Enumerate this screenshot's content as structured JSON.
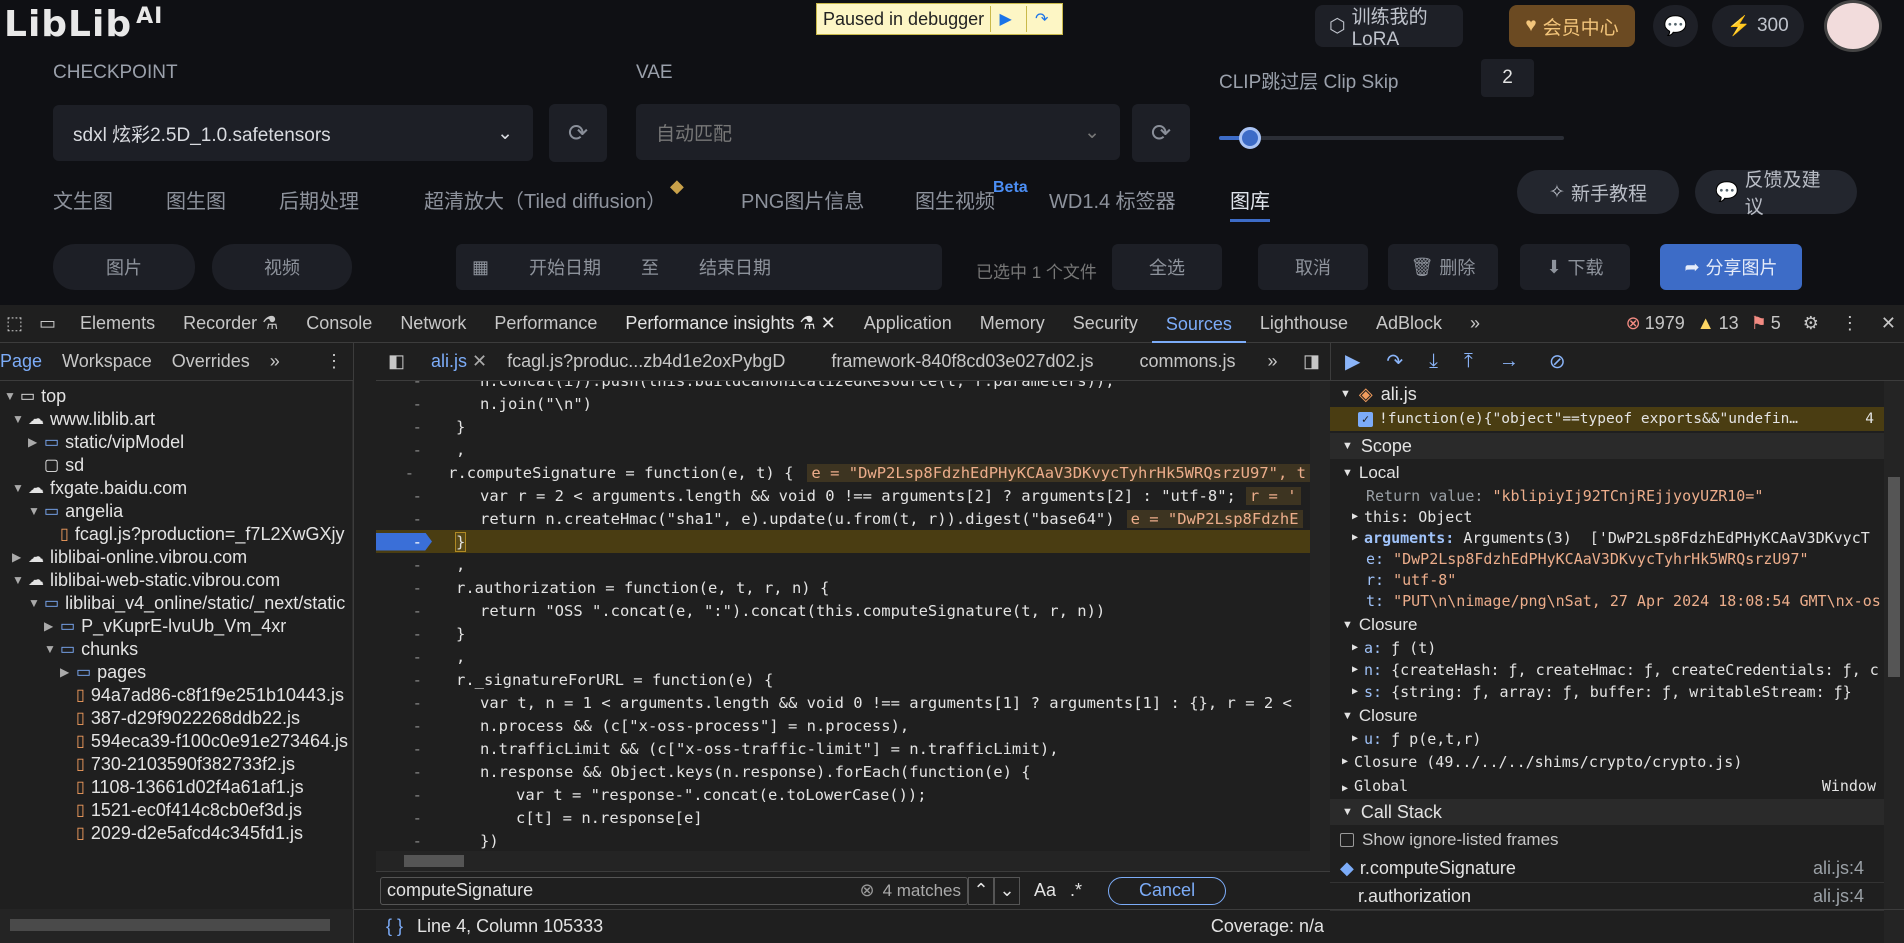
{
  "app": {
    "logo_text": "LibLib",
    "logo_suffix": "AI",
    "paused_label": "Paused in debugger",
    "train_button": "训练我的LoRA",
    "vip_button": "会员中心",
    "points": "300",
    "checkpoint_label": "CHECKPOINT",
    "checkpoint_value": "sdxl 炫彩2.5D_1.0.safetensors",
    "vae_label": "VAE",
    "vae_value": "自动匹配",
    "clip_label": "CLIP跳过层 Clip Skip",
    "clip_value": "2",
    "clip_slider_fraction": 0.09,
    "tabs": [
      "文生图",
      "图生图",
      "后期处理",
      "超清放大（Tiled diffusion）",
      "PNG图片信息",
      "图生视频",
      "WD1.4 标签器",
      "图库"
    ],
    "beta": "Beta",
    "tutorial_button": "新手教程",
    "feedback_button": "反馈及建议",
    "row2": [
      "图片",
      "视频",
      "开始日期",
      "至",
      "结束日期",
      "已选中 1 个文件",
      "全选",
      "取消",
      "删除",
      "下载",
      "分享图片"
    ]
  },
  "devtools": {
    "main_tabs": [
      "Elements",
      "Recorder",
      "Console",
      "Network",
      "Performance",
      "Performance insights",
      "Application",
      "Memory",
      "Security",
      "Sources",
      "Lighthouse",
      "AdBlock"
    ],
    "errors": "1979",
    "warnings": "13",
    "issues": "5",
    "nav_tabs": [
      "Page",
      "Workspace",
      "Overrides"
    ],
    "file_tabs": [
      "ali.js",
      "fcagl.js?produc...zb4d1e2oxPybgD",
      "framework-840f8cd03e027d02.js",
      "commons.js"
    ],
    "tree": [
      {
        "label": "top",
        "icon": "frame"
      },
      {
        "label": "www.liblib.art",
        "icon": "cloud"
      },
      {
        "label": "static/vipModel",
        "icon": "folder"
      },
      {
        "label": "sd",
        "icon": "file"
      },
      {
        "label": "fxgate.baidu.com",
        "icon": "cloud"
      },
      {
        "label": "angelia",
        "icon": "folder"
      },
      {
        "label": "fcagl.js?production=_f7L2XwGXjy",
        "icon": "file"
      },
      {
        "label": "liblibai-online.vibrou.com",
        "icon": "cloud"
      },
      {
        "label": "liblibai-web-static.vibrou.com",
        "icon": "cloud"
      },
      {
        "label": "liblibai_v4_online/static/_next/static",
        "icon": "folder"
      },
      {
        "label": "P_vKuprE-lvuUb_Vm_4xr",
        "icon": "folder"
      },
      {
        "label": "chunks",
        "icon": "folder"
      },
      {
        "label": "pages",
        "icon": "folder"
      },
      {
        "label": "94a7ad86-c8f1f9e251b10443.js",
        "icon": "file"
      },
      {
        "label": "387-d29f9022268ddb22.js",
        "icon": "file"
      },
      {
        "label": "594eca39-f100c0e91e273464.js",
        "icon": "file"
      },
      {
        "label": "730-2103590f382733f2.js",
        "icon": "file"
      },
      {
        "label": "1108-13661d02f4a61af1.js",
        "icon": "file"
      },
      {
        "label": "1521-ec0f414c8cb0ef3d.js",
        "icon": "file"
      },
      {
        "label": "2029-d2e5afcd4c345fd1.js",
        "icon": "file"
      }
    ],
    "gutter_mark": "-",
    "code_lines": [
      "n.concat(i)).push(this.buildCanonicalizedResource(t, r.parameters));",
      "n.join(\"\\n\")",
      "}",
      ",",
      "r.computeSignature = function(e, t) {",
      "var r = 2 < arguments.length && void 0 !== arguments[2] ? arguments[2] : \"utf-8\";",
      "return n.createHmac(\"sha1\", e).update(u.from(t, r)).digest(\"base64\")",
      "}",
      ",",
      "r.authorization = function(e, t, r, n) {",
      "return \"OSS \".concat(e, \":\").concat(this.computeSignature(t, r, n))",
      "}",
      ",",
      "r._signatureForURL = function(e) {",
      "var t, n = 1 < arguments.length && void 0 !== arguments[1] ? arguments[1] : {}, r = 2 <",
      "n.process && (c[\"x-oss-process\"] = n.process),",
      "n.trafficLimit && (c[\"x-oss-traffic-limit\"] = n.trafficLimit),",
      "n.response && Object.keys(n.response).forEach(function(e) {",
      "var t = \"response-\".concat(e.toLowerCase());",
      "c[t] = n.response[e]",
      "})"
    ],
    "inline_e": "e = \"DwP2Lsp8FdzhEdPHyKCAaV3DKvycTyhrHk5WRQsrzU97\", t",
    "inline_r": "r = '",
    "inline_ret": "e = \"DwP2Lsp8FdzhE",
    "breakpoint_file": "ali.js",
    "breakpoint_code": "!function(e){\"object\"==typeof exports&&\"undefin…",
    "breakpoint_line": "4",
    "scope_label": "Scope",
    "local_label": "Local",
    "return_value": "\"kblipiyIj92TCnjREjjyoyUZR10=\"",
    "this_value": "Object",
    "arguments_value": "Arguments(3)  ['DwP2Lsp8FdzhEdPHyKCAaV3DKvycT",
    "e_value": "\"DwP2Lsp8FdzhEdPHyKCAaV3DKvycTyhrHk5WRQsrzU97\"",
    "r_value": "\"utf-8\"",
    "t_value": "\"PUT\\n\\nimage/png\\nSat, 27 Apr 2024 18:08:54 GMT\\nx-os",
    "closure_label": "Closure",
    "a_value": "ƒ (t)",
    "n_value": "{createHash: ƒ, createHmac: ƒ, createCredentials: ƒ, c",
    "s_value": "{string: ƒ, array: ƒ, buffer: ƒ, writableStream: ƒ}",
    "u_value": "ƒ p(e,t,r)",
    "closure3": "Closure (49../../../shims/crypto/crypto.js)",
    "global_label": "Global",
    "global_value": "Window",
    "callstack_label": "Call Stack",
    "ignore_label": "Show ignore-listed frames",
    "stack": [
      {
        "fn": "r.computeSignature",
        "loc": "ali.js:4"
      },
      {
        "fn": "r.authorization",
        "loc": "ali.js:4"
      }
    ],
    "search_value": "computeSignature",
    "matches": "4 matches",
    "cancel": "Cancel",
    "aa": "Aa",
    "regex": ".*",
    "status": "Line 4, Column 105333",
    "coverage": "Coverage: n/a"
  }
}
